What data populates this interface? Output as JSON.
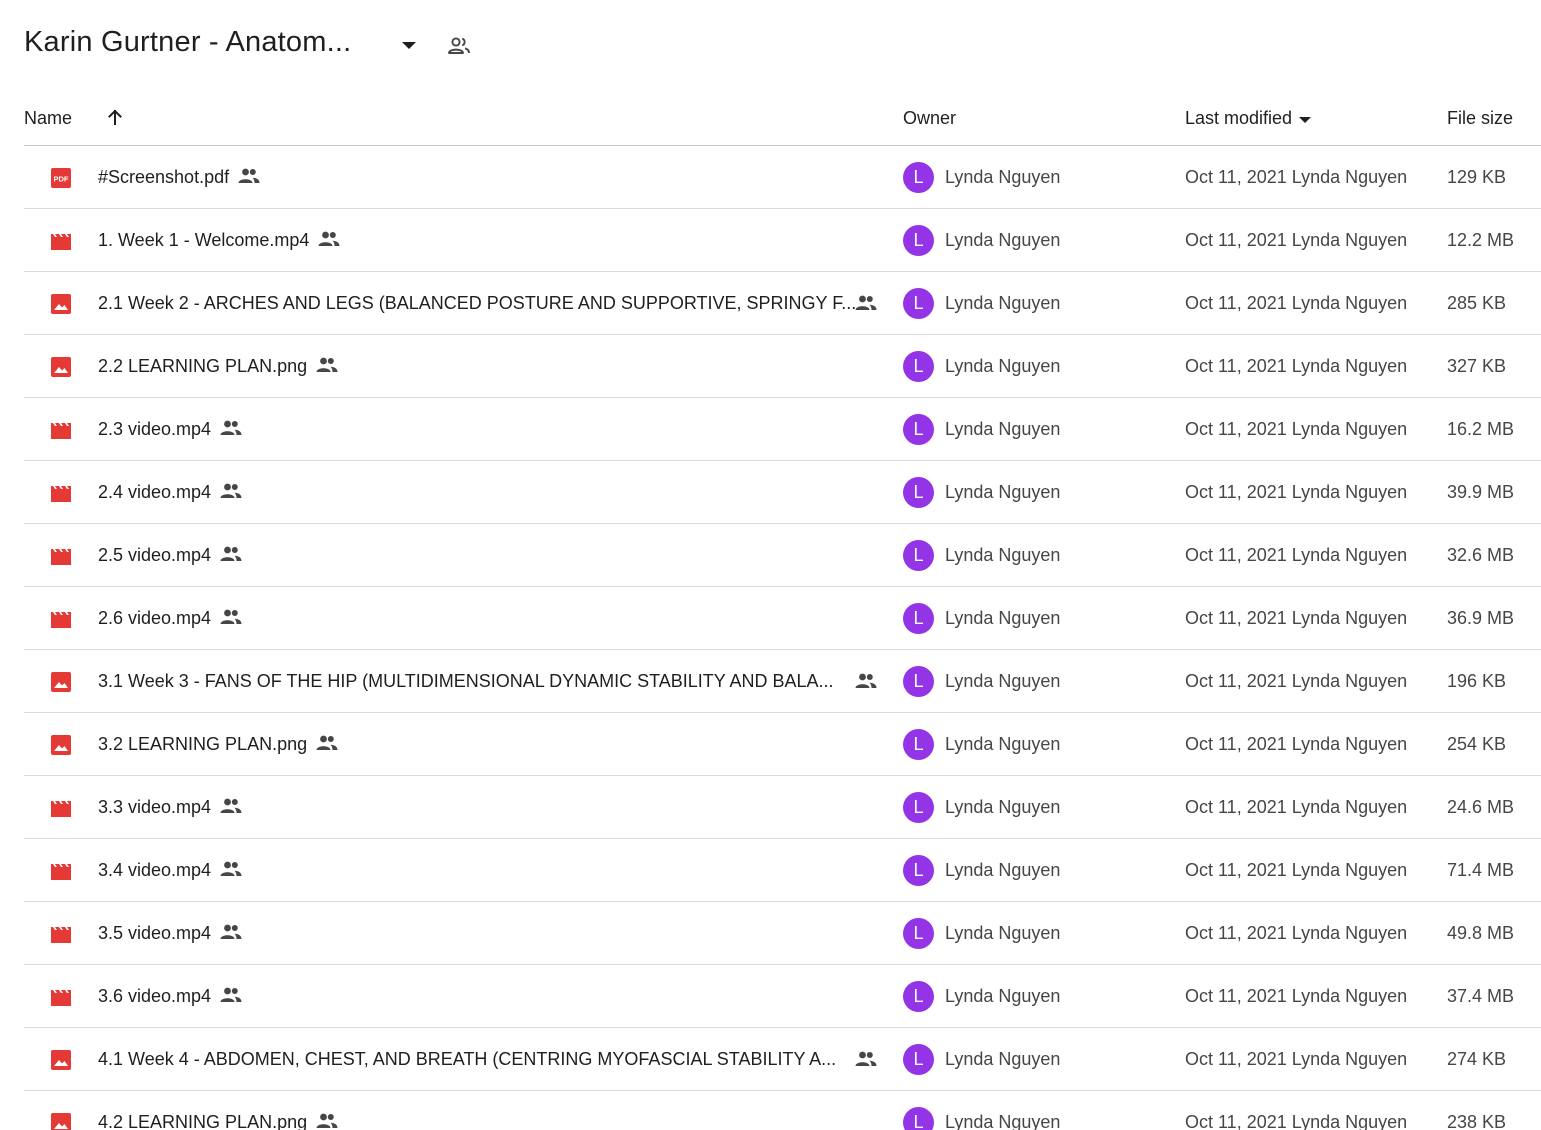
{
  "header": {
    "folder_title": "Karin Gurtner - Anatom..."
  },
  "columns": {
    "name": "Name",
    "owner": "Owner",
    "last_modified": "Last modified",
    "file_size": "File size"
  },
  "colors": {
    "file_icon_red": "#e53935",
    "avatar_purple": "#9334e6",
    "text_secondary": "#444746"
  },
  "rows": [
    {
      "icon": "pdf-icon",
      "name": "#Screenshot.pdf",
      "share_pos": "inline",
      "avatar": "L",
      "owner": "Lynda Nguyen",
      "modified": "Oct 11, 2021 Lynda Nguyen",
      "size": "129 KB"
    },
    {
      "icon": "video-icon",
      "name": "1. Week 1 - Welcome.mp4",
      "share_pos": "inline",
      "avatar": "L",
      "owner": "Lynda Nguyen",
      "modified": "Oct 11, 2021 Lynda Nguyen",
      "size": "12.2 MB"
    },
    {
      "icon": "image-icon",
      "name": "2.1 Week 2 - ARCHES AND LEGS (BALANCED POSTURE AND SUPPORTIVE, SPRINGY F...",
      "share_pos": "right",
      "avatar": "L",
      "owner": "Lynda Nguyen",
      "modified": "Oct 11, 2021 Lynda Nguyen",
      "size": "285 KB"
    },
    {
      "icon": "image-icon",
      "name": "2.2 LEARNING PLAN.png",
      "share_pos": "inline",
      "avatar": "L",
      "owner": "Lynda Nguyen",
      "modified": "Oct 11, 2021 Lynda Nguyen",
      "size": "327 KB"
    },
    {
      "icon": "video-icon",
      "name": "2.3 video.mp4",
      "share_pos": "inline",
      "avatar": "L",
      "owner": "Lynda Nguyen",
      "modified": "Oct 11, 2021 Lynda Nguyen",
      "size": "16.2 MB"
    },
    {
      "icon": "video-icon",
      "name": "2.4 video.mp4",
      "share_pos": "inline",
      "avatar": "L",
      "owner": "Lynda Nguyen",
      "modified": "Oct 11, 2021 Lynda Nguyen",
      "size": "39.9 MB"
    },
    {
      "icon": "video-icon",
      "name": "2.5 video.mp4",
      "share_pos": "inline",
      "avatar": "L",
      "owner": "Lynda Nguyen",
      "modified": "Oct 11, 2021 Lynda Nguyen",
      "size": "32.6 MB"
    },
    {
      "icon": "video-icon",
      "name": "2.6 video.mp4",
      "share_pos": "inline",
      "avatar": "L",
      "owner": "Lynda Nguyen",
      "modified": "Oct 11, 2021 Lynda Nguyen",
      "size": "36.9 MB"
    },
    {
      "icon": "image-icon",
      "name": "3.1 Week 3 - FANS OF THE HIP (MULTIDIMENSIONAL DYNAMIC STABILITY AND BALA...",
      "share_pos": "right",
      "avatar": "L",
      "owner": "Lynda Nguyen",
      "modified": "Oct 11, 2021 Lynda Nguyen",
      "size": "196 KB"
    },
    {
      "icon": "image-icon",
      "name": "3.2 LEARNING PLAN.png",
      "share_pos": "inline",
      "avatar": "L",
      "owner": "Lynda Nguyen",
      "modified": "Oct 11, 2021 Lynda Nguyen",
      "size": "254 KB"
    },
    {
      "icon": "video-icon",
      "name": "3.3 video.mp4",
      "share_pos": "inline",
      "avatar": "L",
      "owner": "Lynda Nguyen",
      "modified": "Oct 11, 2021 Lynda Nguyen",
      "size": "24.6 MB"
    },
    {
      "icon": "video-icon",
      "name": "3.4 video.mp4",
      "share_pos": "inline",
      "avatar": "L",
      "owner": "Lynda Nguyen",
      "modified": "Oct 11, 2021 Lynda Nguyen",
      "size": "71.4 MB"
    },
    {
      "icon": "video-icon",
      "name": "3.5 video.mp4",
      "share_pos": "inline",
      "avatar": "L",
      "owner": "Lynda Nguyen",
      "modified": "Oct 11, 2021 Lynda Nguyen",
      "size": "49.8 MB"
    },
    {
      "icon": "video-icon",
      "name": "3.6 video.mp4",
      "share_pos": "inline",
      "avatar": "L",
      "owner": "Lynda Nguyen",
      "modified": "Oct 11, 2021 Lynda Nguyen",
      "size": "37.4 MB"
    },
    {
      "icon": "image-icon",
      "name": "4.1 Week 4 - ABDOMEN, CHEST, AND BREATH (CENTRING MYOFASCIAL STABILITY A...",
      "share_pos": "right",
      "avatar": "L",
      "owner": "Lynda Nguyen",
      "modified": "Oct 11, 2021 Lynda Nguyen",
      "size": "274 KB"
    },
    {
      "icon": "image-icon",
      "name": "4.2 LEARNING PLAN.png",
      "share_pos": "inline",
      "avatar": "L",
      "owner": "Lynda Nguyen",
      "modified": "Oct 11, 2021 Lynda Nguyen",
      "size": "238 KB"
    }
  ]
}
